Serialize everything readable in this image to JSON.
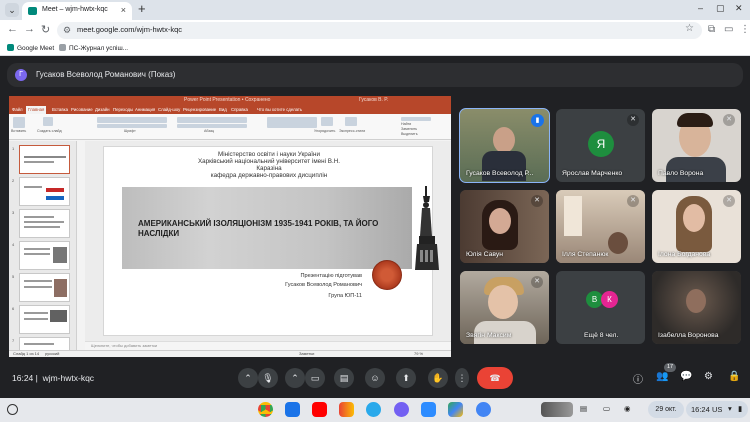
{
  "browser": {
    "tab_title": "Meet – wjm-hwtx-kqc",
    "url": "meet.google.com/wjm-hwtx-kqc",
    "bookmarks": [
      "Google Meet",
      "ПС-Журнал успіш..."
    ]
  },
  "presenter": {
    "avatar_letter": "Г",
    "label": "Гусаков Всеволод Романович (Показ)"
  },
  "ppt": {
    "window_title": "Power Point Presentation • Сохранено",
    "user": "Гусаков В. Р.",
    "menu": [
      "Файл",
      "Главная",
      "Вставка",
      "Рисование",
      "Дизайн",
      "Переходы",
      "Анимация",
      "Слайд-шоу",
      "Рецензирование",
      "Вид",
      "Справка",
      "Что вы хотите сделать"
    ],
    "ribbon_labels": [
      "Вставить",
      "Создать слайд",
      "Шрифт",
      "Абзац",
      "Упорядочить",
      "Экспресс-стили",
      "Найти",
      "Заменить",
      "Выделить"
    ],
    "notes_placeholder": "Щелкните, чтобы добавить заметки",
    "status": {
      "slide": "Слайд 1 из 14",
      "language": "русский",
      "notes": "Заметки",
      "zoom": "79 %"
    },
    "slide": {
      "ministry": "Міністерство освіти і науки України",
      "university": "Харківський національний університет імені В.Н.",
      "university2": "Каразіна",
      "department": "кафедра державно-правових дисциплін",
      "title": "АМЕРИКАНСЬКИЙ ІЗОЛЯЦІОНІЗМ 1935-1941 РОКІВ, ТА ЙОГО НАСЛІДКИ",
      "prepared_by": "Презентацію підготував",
      "author": "Гусаков Всеволод Романович",
      "group": "Група ЮП-11"
    },
    "thumb_numbers": [
      "1",
      "2",
      "3",
      "4",
      "5",
      "6",
      "7"
    ]
  },
  "participants": [
    {
      "name": "Гусаков Всеволод Р...",
      "speaking": true
    },
    {
      "name": "Ярослав Марченко",
      "avatar": "Я",
      "avatar_color": "#1e8e3e"
    },
    {
      "name": "Павло Ворона"
    },
    {
      "name": "Юлія Савун"
    },
    {
      "name": "Ілля Степанюк"
    },
    {
      "name": "Ілона Богданова"
    },
    {
      "name": "Звягін Максим"
    },
    {
      "name": "Ещё 8 чел.",
      "avatars": [
        "В",
        "К"
      ],
      "avatar_colors": [
        "#1e8e3e",
        "#e52592"
      ]
    },
    {
      "name": "Ізабелла Воронова"
    }
  ],
  "meetbar": {
    "time": "16:24",
    "code": "wjm-hwtx-kqc",
    "participants_count": "17"
  },
  "shelf": {
    "date": "29 окт.",
    "time": "16:24",
    "region": "US"
  },
  "colors": {
    "ppt_accent": "#b7472a",
    "meet_bg": "#202124",
    "end_call": "#ea4335",
    "speaking_blue": "#1a73e8"
  }
}
